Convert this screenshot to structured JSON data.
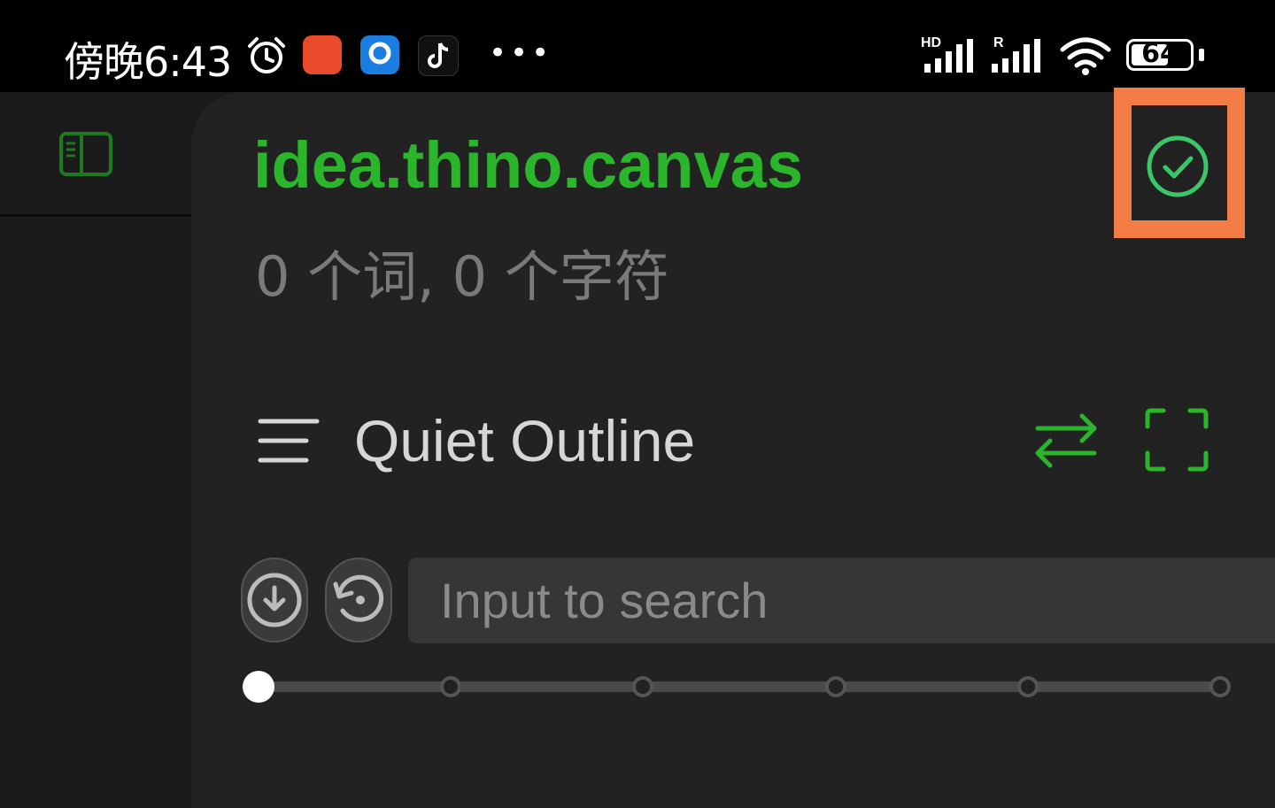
{
  "status_bar": {
    "time": "傍晚6:43",
    "more": "•••",
    "battery_level": "64",
    "battery_fraction": 0.64,
    "signal_labels": [
      "HD",
      "R"
    ]
  },
  "sidebar": {
    "toggle_icon": "sidebar-toggle-icon"
  },
  "note": {
    "title": "idea.thino.canvas",
    "stats": "0 个词, 0 个字符"
  },
  "outline": {
    "title": "Quiet Outline",
    "search": {
      "placeholder": "Input to search",
      "value": ""
    },
    "level_slider": {
      "levels": 6,
      "current_level_index": 0
    }
  },
  "colors": {
    "accent_green": "#2bb52b",
    "highlight_orange": "#f47c45",
    "check_circle": "#3cc66a"
  }
}
